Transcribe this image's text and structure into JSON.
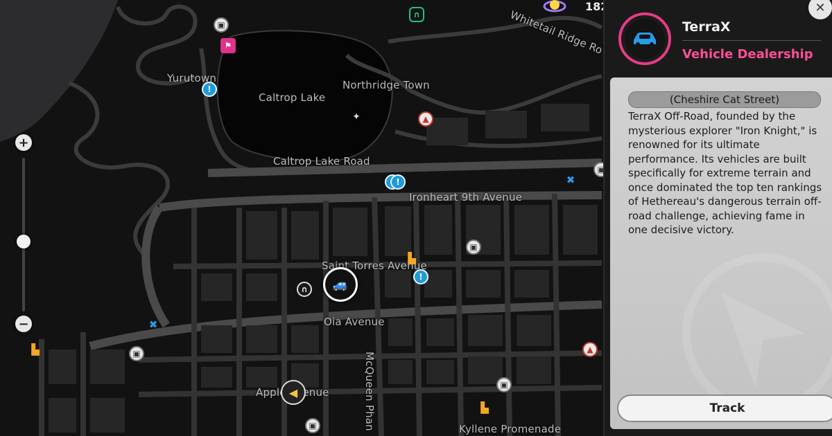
{
  "map": {
    "labels": {
      "whitetail": "Whitetail Ridge Ro",
      "yurutown": "Yurutown",
      "caltrop_lake": "Caltrop Lake",
      "northridge": "Northridge Town",
      "caltrop_road": "Caltrop Lake Road",
      "ironheart": "Ironheart 9th Avenue",
      "saint_torres": "Saint Torres Avenue",
      "oia": "Oia Avenue",
      "mcqueen": "McQueen Phan",
      "apple": "Apple Avenue",
      "kyllene": "Kyllene Promenade"
    }
  },
  "hud": {
    "currency_value": "182"
  },
  "zoom": {
    "plus": "+",
    "minus": "−",
    "level": 0.55
  },
  "panel": {
    "close_label": "✕",
    "name": "TerraX",
    "category": "Vehicle Dealership",
    "street": "(Cheshire Cat Street)",
    "description": "TerraX Off-Road, founded by the mysterious explorer \"Iron Knight,\" is renowned for its ultimate performance. Its vehicles are built specifically for extreme terrain and once dominated the top ten rankings of Hethereau's dangerous terrain off-road challenge, achieving fame in one decisive victory.",
    "track_label": "Track"
  },
  "colors": {
    "accent": "#ff4f97",
    "badge_ring": "#e63b86",
    "car_blue": "#2a9be6"
  },
  "icons": {
    "dealership": "car-icon",
    "shop": "shop-icon",
    "info": "info-icon",
    "repair": "wrench-icon",
    "rocket": "rocket-icon",
    "flag": "checkered-flag-icon"
  }
}
